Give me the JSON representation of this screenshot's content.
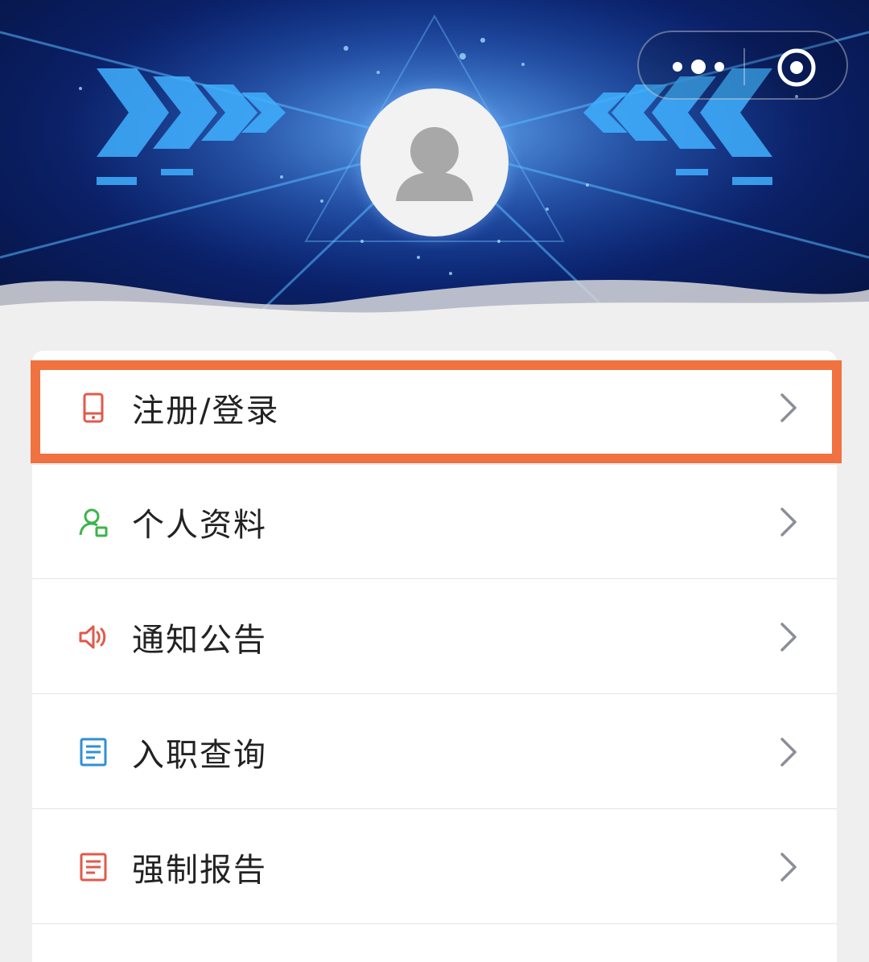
{
  "header": {
    "avatar_icon": "default-user-avatar-icon",
    "capsule": {
      "more_icon": "more-dots-icon",
      "close_icon": "target-circle-icon"
    }
  },
  "menu": {
    "items": [
      {
        "label": "注册/登录",
        "icon": "phone-icon",
        "icon_color": "#e15a4a"
      },
      {
        "label": "个人资料",
        "icon": "user-profile-icon",
        "icon_color": "#3bb54a"
      },
      {
        "label": "通知公告",
        "icon": "speaker-icon",
        "icon_color": "#e15a4a"
      },
      {
        "label": "入职查询",
        "icon": "document-icon",
        "icon_color": "#2f8fd8"
      },
      {
        "label": "强制报告",
        "icon": "document-icon",
        "icon_color": "#e15a4a"
      }
    ]
  },
  "highlight_color": "#f07240"
}
